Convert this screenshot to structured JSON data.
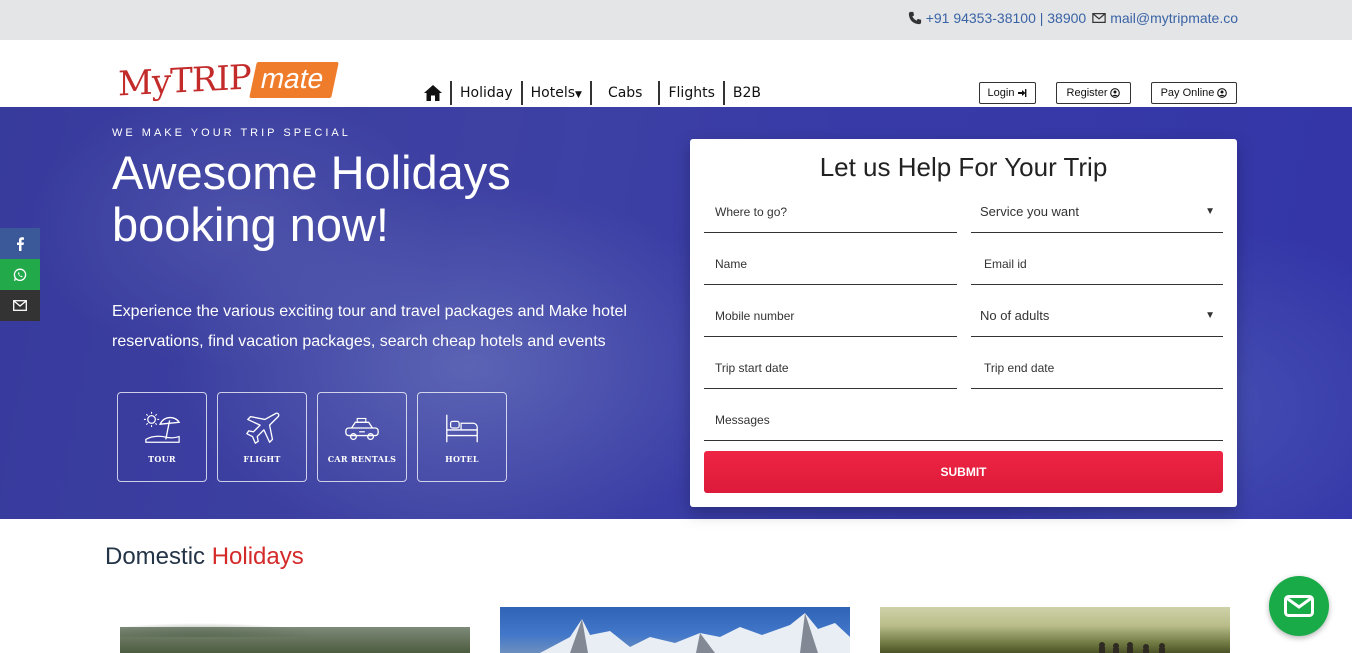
{
  "topbar": {
    "phone": "+91 94353-38100 | 38900",
    "email": "mail@mytripmate.co"
  },
  "logo": {
    "part1": "MyTRIP",
    "part2": "mate"
  },
  "nav": {
    "items": [
      "Holiday",
      "Hotels",
      "Cabs",
      "Flights",
      "B2B"
    ]
  },
  "header_buttons": {
    "login": "Login",
    "register": "Register",
    "pay": "Pay Online"
  },
  "hero": {
    "kicker": "WE MAKE YOUR TRIP SPECIAL",
    "title": "Awesome Holidays booking now!",
    "description": "Experience the various exciting tour and travel packages and Make hotel reservations, find vacation packages, search cheap hotels and events",
    "services": [
      "TOUR",
      "FLIGHT",
      "CAR RENTALS",
      "HOTEL"
    ]
  },
  "form": {
    "title": "Let us Help For Your Trip",
    "where_placeholder": "Where to go?",
    "service_select": "Service you want",
    "name_placeholder": "Name",
    "email_placeholder": "Email id",
    "mobile_placeholder": "Mobile number",
    "adults_select": "No of adults",
    "start_placeholder": "Trip start date",
    "end_placeholder": "Trip end date",
    "messages_placeholder": "Messages",
    "submit": "SUBMIT"
  },
  "section": {
    "title_part1": "Domestic",
    "title_part2": "Holidays"
  },
  "colors": {
    "brand_red": "#d42a2a",
    "brand_orange": "#ef7c2a",
    "submit": "#e41f3e",
    "chat": "#1aab49",
    "link_blue": "#3a63a6"
  }
}
